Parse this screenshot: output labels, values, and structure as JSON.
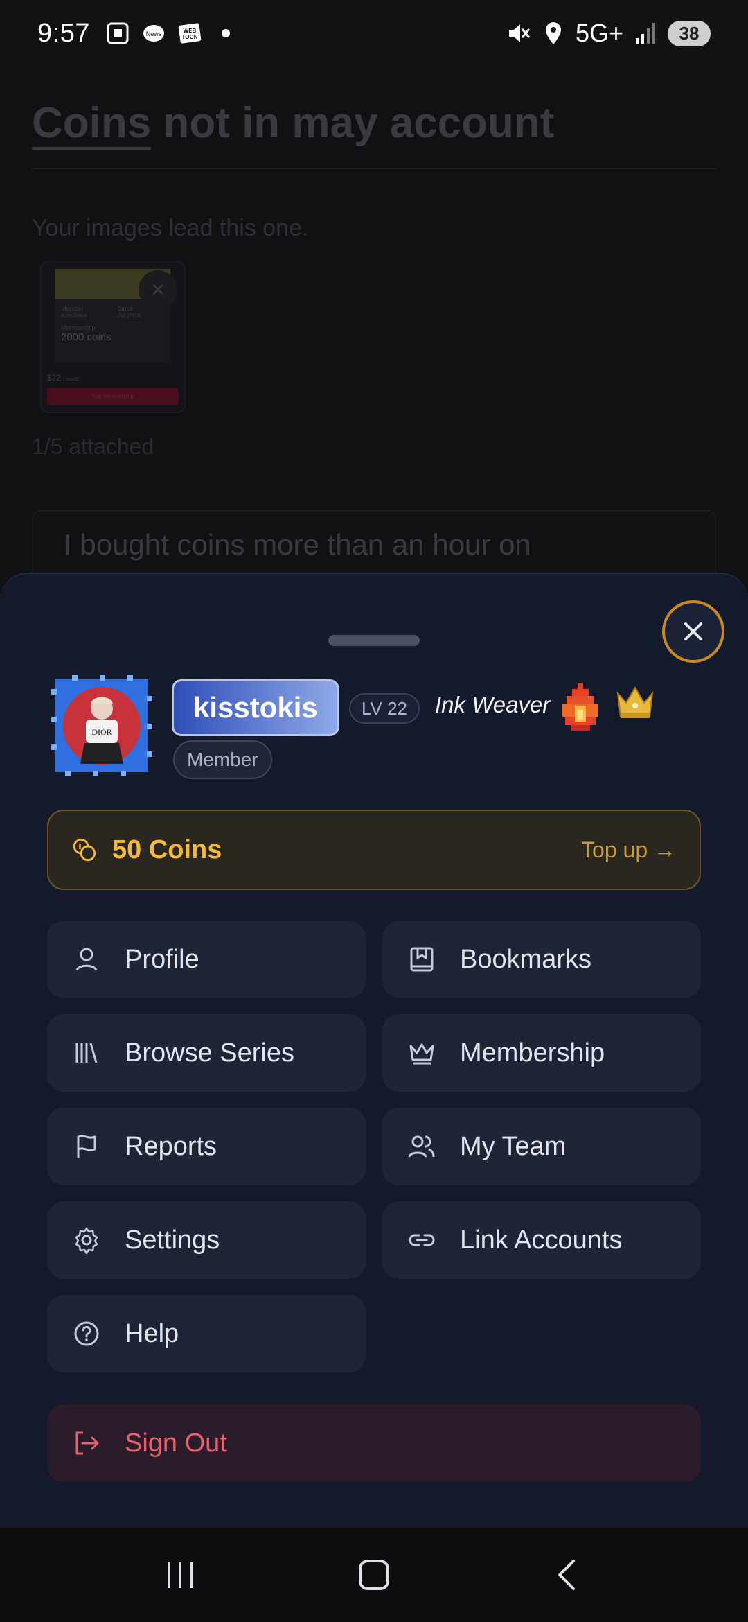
{
  "status_bar": {
    "time": "9:57",
    "network": "5G+",
    "battery": "38",
    "notification_icons": [
      "screenshot-icon",
      "news-icon",
      "webtoon-icon",
      "dot-icon"
    ],
    "status_icons": [
      "mute-icon",
      "location-icon",
      "signal-icon"
    ]
  },
  "background_page": {
    "title_underlined": "Coins",
    "title_rest": " not in may account",
    "hint": "Your images lead this one.",
    "thumbnail": {
      "col1_label": "Member",
      "col1_value": "KissTokis",
      "col2_label": "Since",
      "col2_value": "Jul 2026",
      "balance_label": "Membership",
      "balance_value": "2000 coins",
      "price": "$22",
      "price_unit": "/ month",
      "button": "Edit membership"
    },
    "attached": "1/5 attached",
    "message": "I bought coins more than an hour on"
  },
  "sheet": {
    "username": "kisstokis",
    "level": "LV 22",
    "user_title": "Ink Weaver",
    "role": "Member",
    "coins": {
      "label": "50 Coins",
      "topup": "Top up →"
    },
    "menu": [
      {
        "label": "Profile",
        "icon": "user-icon"
      },
      {
        "label": "Bookmarks",
        "icon": "bookmark-icon"
      },
      {
        "label": "Browse Series",
        "icon": "library-icon"
      },
      {
        "label": "Membership",
        "icon": "crown-icon"
      },
      {
        "label": "Reports",
        "icon": "flag-icon"
      },
      {
        "label": "My Team",
        "icon": "team-icon"
      },
      {
        "label": "Settings",
        "icon": "gear-icon"
      },
      {
        "label": "Link Accounts",
        "icon": "link-icon"
      },
      {
        "label": "Help",
        "icon": "help-icon"
      }
    ],
    "sign_out": "Sign Out"
  },
  "colors": {
    "sheet_bg": "#141a2b",
    "accent_gold": "#f5b93a",
    "danger": "#e8616d",
    "close_ring": "#c98a1e"
  }
}
